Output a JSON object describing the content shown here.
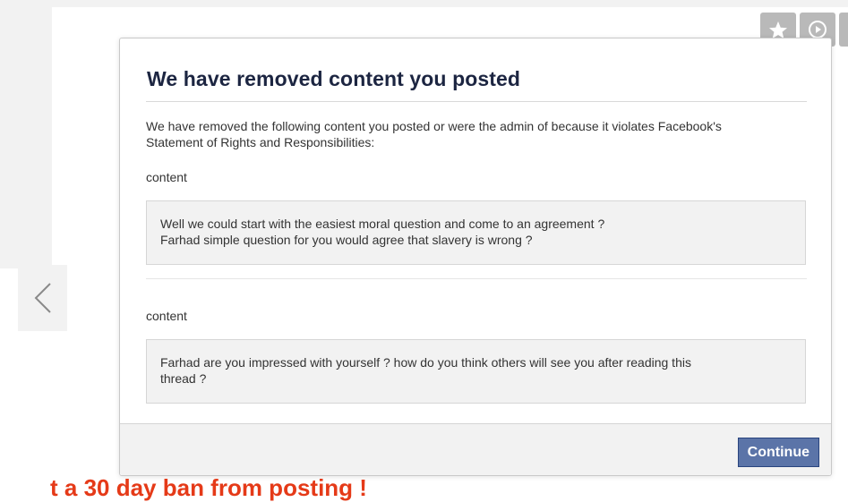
{
  "toolbar": {
    "icons": [
      "star-icon",
      "play-circle-icon",
      "next-tool-icon"
    ]
  },
  "navigation": {
    "prev_icon": "chevron-left-icon"
  },
  "dialog": {
    "title": "We have removed content you posted",
    "intro_line1": "We have removed the following content you posted or were the admin of because it violates Facebook's",
    "intro_line2": "Statement of Rights and Responsibilities:",
    "items": [
      {
        "label": "content",
        "lines": [
          "Well we could start with the easiest moral question and come to an agreement ?",
          "Farhad simple question for you would agree that slavery is wrong ?"
        ]
      },
      {
        "label": "content",
        "lines": [
          "Farhad are you impressed with yourself ? how do you think others will see you after reading this",
          "thread ?"
        ]
      }
    ],
    "continue_label": "Continue"
  },
  "background": {
    "ban_text": "t a 30 day ban from posting !"
  },
  "colors": {
    "title": "#1c2541",
    "button_bg": "#5b74a8",
    "button_border": "#29447e",
    "ban_text": "#e53a18",
    "panel_bg": "#f2f2f2"
  }
}
